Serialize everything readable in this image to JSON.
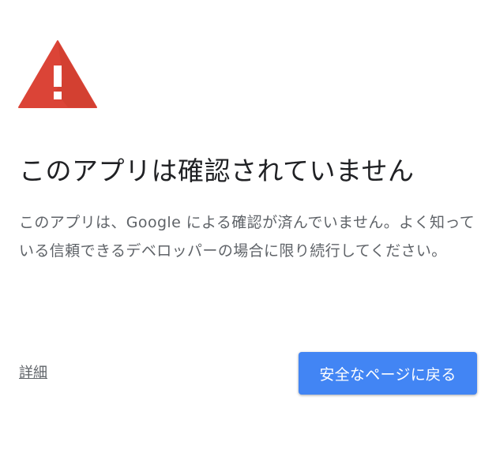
{
  "page": {
    "title": "このアプリは確認されていません",
    "description": "このアプリは、Google による確認が済んでいません。よく知っている信頼できるデベロッパーの場合に限り続行してください。"
  },
  "actions": {
    "details_link": "詳細",
    "back_to_safety_button": "安全なページに戻る"
  },
  "icons": {
    "warning": "warning-triangle-icon"
  },
  "colors": {
    "warning_red": "#db4437",
    "primary_button": "#4285f4",
    "title_text": "#202124",
    "body_text": "#5f6368"
  }
}
